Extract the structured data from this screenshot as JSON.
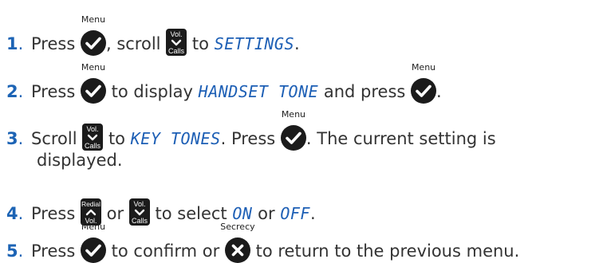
{
  "colors": {
    "accent": "#1d64b5",
    "icon_fill": "#1b1b1b",
    "lcd_text": "#1d5fb5"
  },
  "icons": {
    "menu_caption": "Menu",
    "secrecy_caption": "Secrecy",
    "redial_caption": "Redial",
    "vol_label": "Vol.",
    "calls_label": "Calls"
  },
  "steps": [
    {
      "number": "1",
      "t1": "Press",
      "t2": ", scroll",
      "t3": "to",
      "lcd1": "SETTINGS",
      "t4": "."
    },
    {
      "number": "2",
      "t1": "Press",
      "t2": "to display",
      "lcd1": "HANDSET TONE",
      "t3": "and press",
      "t4": "."
    },
    {
      "number": "3",
      "t1": "Scroll",
      "t2": "to",
      "lcd1": "KEY TONES",
      "t3": ". Press",
      "t4": ". The current setting is",
      "t5": "displayed."
    },
    {
      "number": "4",
      "t1": "Press",
      "t2": "or",
      "t3": "to select",
      "lcd1": "ON",
      "t4": "or",
      "lcd2": "OFF",
      "t5": "."
    },
    {
      "number": "5",
      "t1": "Press",
      "t2": "to confirm or",
      "t3": "to return to the previous menu."
    }
  ]
}
